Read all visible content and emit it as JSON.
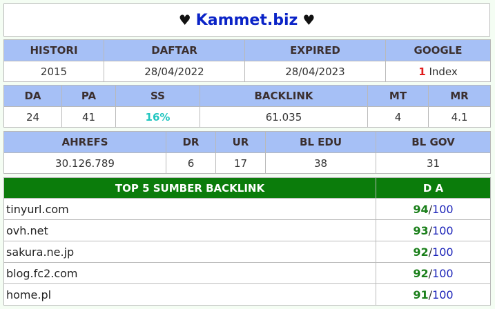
{
  "title": {
    "site": "Kammet.biz",
    "heart": "♥"
  },
  "row1": {
    "headers": [
      "HISTORI",
      "DAFTAR",
      "EXPIRED",
      "GOOGLE"
    ],
    "values": [
      "2015",
      "28/04/2022",
      "28/04/2023"
    ],
    "google_count": "1",
    "google_suffix": "Index"
  },
  "row2": {
    "headers": [
      "DA",
      "PA",
      "SS",
      "BACKLINK",
      "MT",
      "MR"
    ],
    "values": [
      "24",
      "41",
      "16%",
      "61.035",
      "4",
      "4.1"
    ]
  },
  "row3": {
    "headers": [
      "AHREFS",
      "DR",
      "UR",
      "BL EDU",
      "BL GOV"
    ],
    "values": [
      "30.126.789",
      "6",
      "17",
      "38",
      "31"
    ]
  },
  "top": {
    "header_left": "TOP 5 SUMBER BACKLINK",
    "header_right": "D A",
    "max": "100",
    "sep": "/",
    "rows": [
      {
        "domain": "tinyurl.com",
        "da": "94"
      },
      {
        "domain": "ovh.net",
        "da": "93"
      },
      {
        "domain": "sakura.ne.jp",
        "da": "92"
      },
      {
        "domain": "blog.fc2.com",
        "da": "92"
      },
      {
        "domain": "home.pl",
        "da": "91"
      }
    ]
  },
  "colors": {
    "header_blue": "#a6c0f6",
    "header_green": "#0b7c0b",
    "title_blue": "#0a23c7",
    "accent_red": "#e01b1b",
    "accent_teal": "#21c6c0"
  }
}
